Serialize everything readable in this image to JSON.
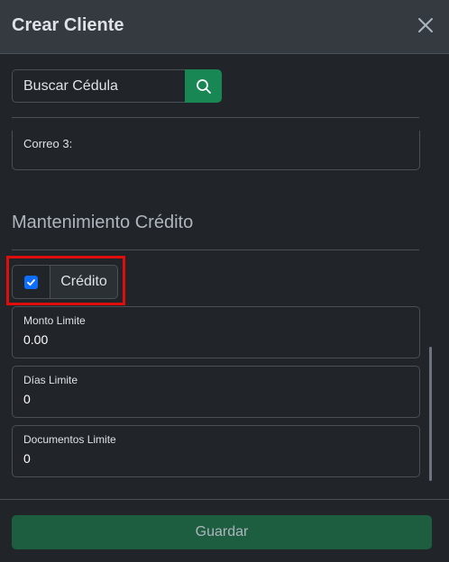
{
  "modal": {
    "title": "Crear Cliente"
  },
  "search": {
    "placeholder": "Buscar Cédula"
  },
  "contact": {
    "correo3_label": "Correo 3:"
  },
  "credit": {
    "section_title": "Mantenimiento Crédito",
    "toggle_label": "Crédito",
    "enabled": true,
    "monto_limite": {
      "label": "Monto Limite",
      "value": "0.00"
    },
    "dias_limite": {
      "label": "Días Limite",
      "value": "0"
    },
    "documentos_limite": {
      "label": "Documentos Limite",
      "value": "0"
    }
  },
  "footer": {
    "save_label": "Guardar"
  },
  "colors": {
    "accent_green": "#198754",
    "checkbox_blue": "#0d6efd",
    "highlight_red": "#e00d0d"
  }
}
